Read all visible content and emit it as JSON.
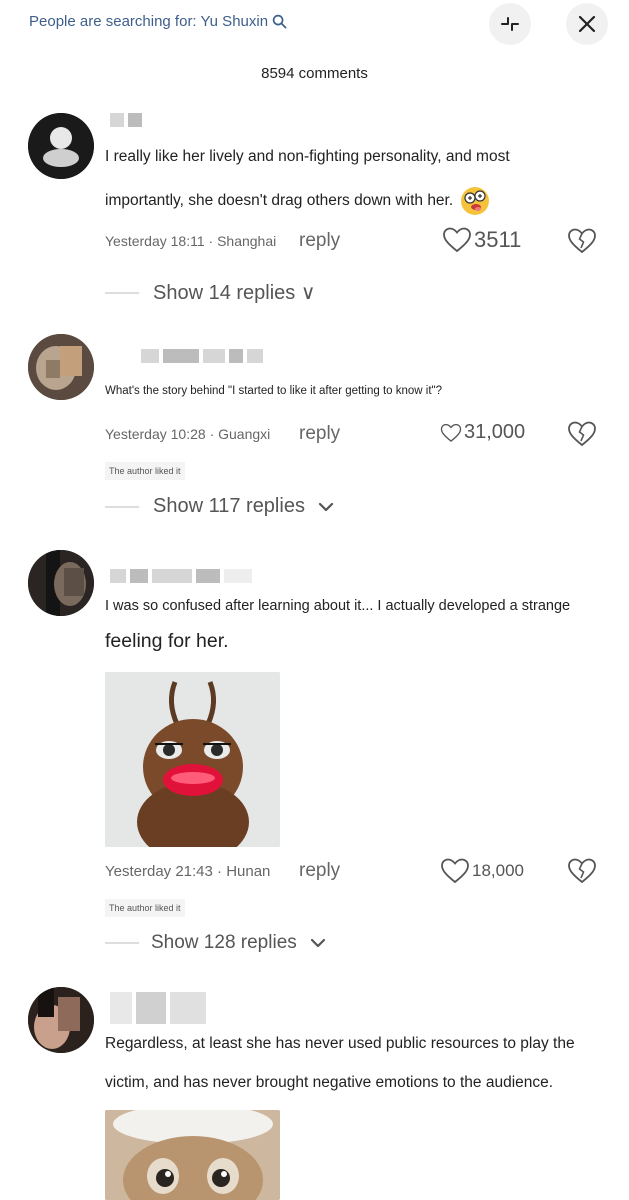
{
  "header": {
    "search_hint": "People are searching for: Yu Shuxin",
    "comment_count": "8594 comments"
  },
  "comments": [
    {
      "text_line1": "I really like her lively and non-fighting personality, and most",
      "text_line2": "importantly, she doesn't drag others down with her.",
      "meta": "Yesterday 18:11 · Shanghai",
      "reply_label": "reply",
      "likes": "3511",
      "replies_label": "Show 14 replies ∨"
    },
    {
      "text": "What's the story behind \"I started to like it after getting to know it\"?",
      "meta": "Yesterday 10:28 · Guangxi",
      "reply_label": "reply",
      "likes": "31,000",
      "author_liked": "The author liked it",
      "replies_label": "Show 117 replies"
    },
    {
      "text_line1": "I was so confused after learning about it... I actually developed a strange",
      "text_line2": "feeling for her.",
      "meta": "Yesterday 21:43 · Hunan",
      "reply_label": "reply",
      "likes": "18,000",
      "author_liked": "The author liked it",
      "replies_label": "Show 128 replies"
    },
    {
      "text_line1": "Regardless, at least she has never used public resources to play the",
      "text_line2": "victim, and has never brought negative emotions to the audience."
    }
  ],
  "colors": {
    "accent": "#3e5f8a",
    "meta": "#666666",
    "divider": "#dddddd"
  }
}
